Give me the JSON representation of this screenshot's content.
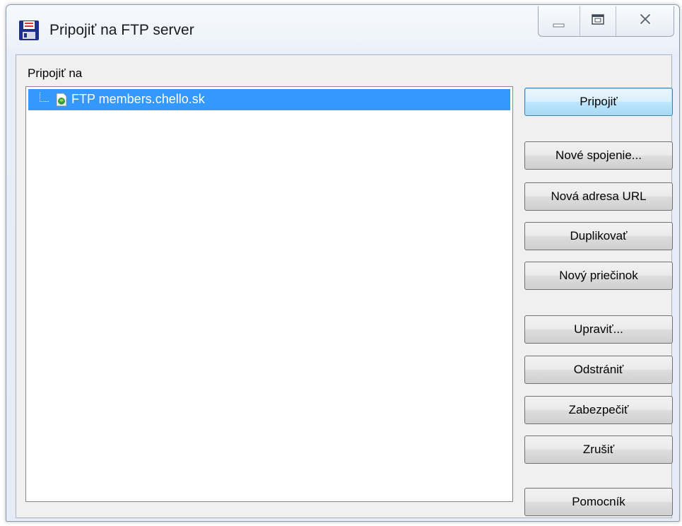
{
  "window": {
    "title": "Pripojiť na FTP server"
  },
  "caption_buttons": {
    "minimize_icon": "minimize-icon",
    "maximize_icon": "maximize-icon",
    "close_icon": "close-icon"
  },
  "connect_to": {
    "label": "Pripojiť na",
    "tree_items": [
      {
        "label": "FTP members.chello.sk",
        "icon": "ftp-site-icon",
        "selected": true
      }
    ]
  },
  "buttons": {
    "connect": "Pripojiť",
    "new_connection": "Nové spojenie...",
    "new_url": "Nová adresa URL",
    "duplicate": "Duplikovať",
    "new_folder": "Nový priečinok",
    "edit": "Upraviť...",
    "remove": "Odstrániť",
    "secure": "Zabezpečiť",
    "cancel": "Zrušiť",
    "help": "Pomocník"
  },
  "colors": {
    "selection": "#3399ff",
    "default_button": "#bee6fd",
    "dialog_face": "#f0f0f0"
  }
}
